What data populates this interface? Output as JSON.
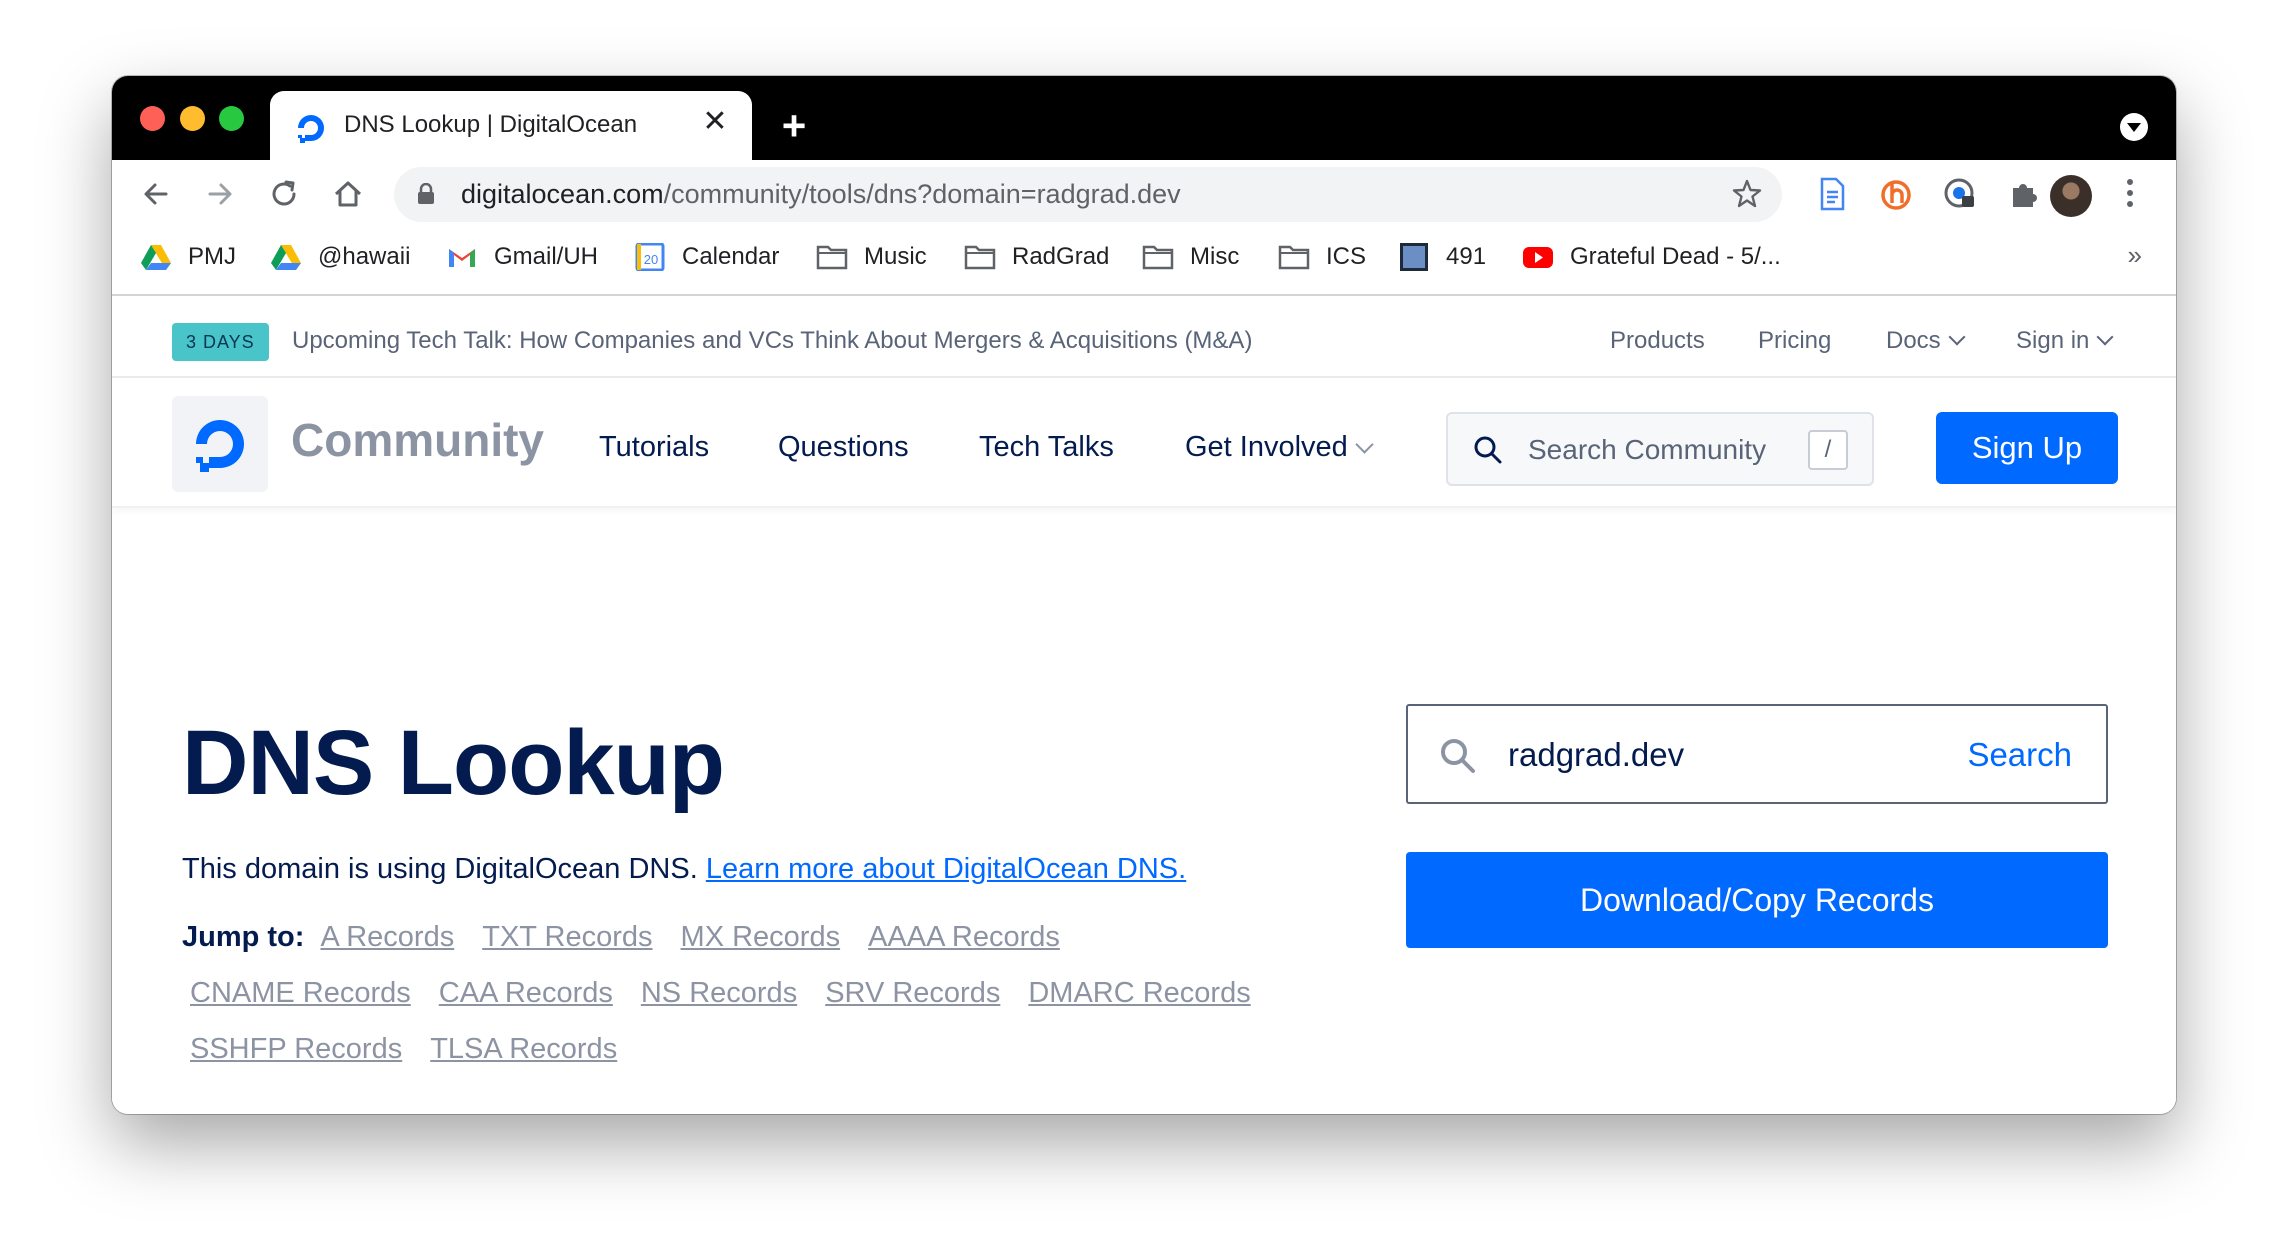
{
  "browser": {
    "tab_title": "DNS Lookup | DigitalOcean",
    "tab_close": "✕",
    "new_tab": "+",
    "url_host": "digitalocean.com",
    "url_path": "/community/tools/dns?domain=radgrad.dev",
    "bookmarks": [
      "PMJ",
      "@hawaii",
      "Gmail/UH",
      "Calendar",
      "Music",
      "RadGrad",
      "Misc",
      "ICS",
      "491",
      "Grateful Dead - 5/..."
    ],
    "bookmarks_more": "»"
  },
  "topbar": {
    "badge": "3 DAYS",
    "announcement": "Upcoming Tech Talk: How Companies and VCs Think About Mergers & Acquisitions (M&A)",
    "links": [
      "Products",
      "Pricing",
      "Docs",
      "Sign in"
    ]
  },
  "nav": {
    "brand": "Community",
    "links": [
      "Tutorials",
      "Questions",
      "Tech Talks",
      "Get Involved"
    ],
    "search_placeholder": "Search Community",
    "search_key": "/",
    "signup": "Sign Up"
  },
  "main": {
    "title": "DNS Lookup",
    "intro_text": "This domain is using DigitalOcean DNS.",
    "intro_link": "Learn more about DigitalOcean DNS.",
    "jump_label": "Jump to:",
    "jump_links": [
      "A Records",
      "TXT Records",
      "MX Records",
      "AAAA Records",
      "CNAME Records",
      "CAA Records",
      "NS Records",
      "SRV Records",
      "DMARC Records",
      "SSHFP Records",
      "TLSA Records"
    ],
    "domain_value": "radgrad.dev",
    "search_button": "Search",
    "download_button": "Download/Copy Records"
  },
  "colors": {
    "accent": "#0069ff",
    "navy": "#031b4e",
    "badge": "#49c4c8",
    "muted": "#8c94a4"
  }
}
